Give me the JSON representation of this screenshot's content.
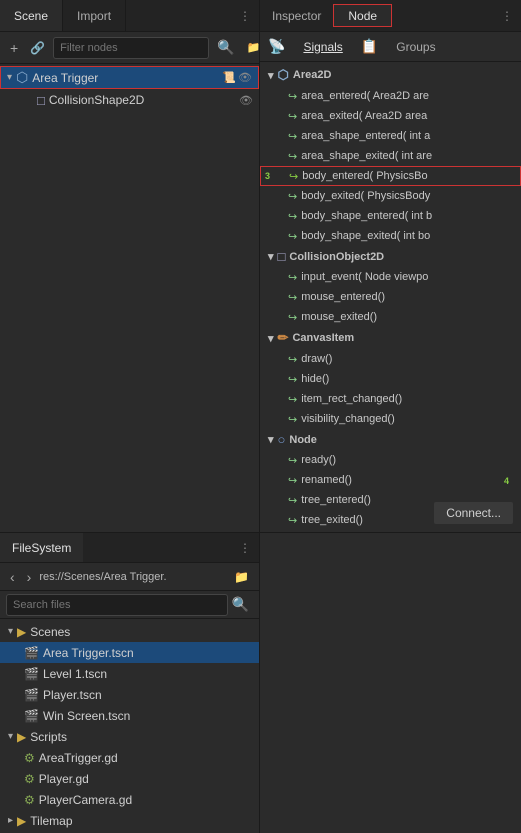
{
  "scene_panel": {
    "tabs": [
      {
        "label": "Scene",
        "active": true
      },
      {
        "label": "Import",
        "active": false
      }
    ],
    "toolbar": {
      "add_label": "+",
      "link_label": "🔗",
      "filter_placeholder": "Filter nodes",
      "search_label": "🔍",
      "folder_label": "📁"
    },
    "tree": [
      {
        "id": "area_trigger",
        "label": "Area Trigger",
        "icon": "⬡",
        "indent": 0,
        "selected": true,
        "has_script": true,
        "visible": true
      },
      {
        "id": "collision_shape",
        "label": "CollisionShape2D",
        "icon": "□",
        "indent": 1,
        "selected": false,
        "has_script": false,
        "visible": true
      }
    ]
  },
  "inspector_panel": {
    "title": "Inspector",
    "tabs": [
      {
        "label": "Node",
        "active": true
      }
    ],
    "sub_tabs": [
      {
        "label": "Signals",
        "active": true,
        "icon": "📡"
      },
      {
        "label": "",
        "icon": "📋"
      },
      {
        "label": "Groups",
        "active": false
      }
    ],
    "signal_groups": [
      {
        "name": "Area2D",
        "signals": [
          {
            "name": "area_entered( Area2D are",
            "connected": false,
            "highlighted": false
          },
          {
            "name": "area_exited( Area2D area",
            "connected": false,
            "highlighted": false
          },
          {
            "name": "area_shape_entered( int a",
            "connected": false,
            "highlighted": false
          },
          {
            "name": "area_shape_exited( int are",
            "connected": false,
            "highlighted": false
          },
          {
            "name": "body_entered( PhysicsBo",
            "connected": true,
            "highlighted": true
          },
          {
            "name": "body_exited( PhysicsBody",
            "connected": false,
            "highlighted": false
          },
          {
            "name": "body_shape_entered( int b",
            "connected": false,
            "highlighted": false
          },
          {
            "name": "body_shape_exited( int bo",
            "connected": false,
            "highlighted": false
          }
        ]
      },
      {
        "name": "CollisionObject2D",
        "signals": [
          {
            "name": "input_event( Node viewpo",
            "connected": false,
            "highlighted": false
          },
          {
            "name": "mouse_entered()",
            "connected": false,
            "highlighted": false
          },
          {
            "name": "mouse_exited()",
            "connected": false,
            "highlighted": false
          }
        ]
      },
      {
        "name": "CanvasItem",
        "signals": [
          {
            "name": "draw()",
            "connected": false,
            "highlighted": false
          },
          {
            "name": "hide()",
            "connected": false,
            "highlighted": false
          },
          {
            "name": "item_rect_changed()",
            "connected": false,
            "highlighted": false
          },
          {
            "name": "visibility_changed()",
            "connected": false,
            "highlighted": false
          }
        ]
      },
      {
        "name": "Node",
        "signals": [
          {
            "name": "ready()",
            "connected": false,
            "highlighted": false
          },
          {
            "name": "renamed()",
            "connected": false,
            "highlighted": false
          },
          {
            "name": "tree_entered()",
            "connected": false,
            "highlighted": false
          },
          {
            "name": "tree_exited()",
            "connected": false,
            "highlighted": false
          }
        ]
      }
    ],
    "connect_btn_label": "Connect...",
    "badge_number": "3",
    "badge_number2": "4"
  },
  "filesystem_panel": {
    "tabs": [
      {
        "label": "FileSystem",
        "active": true
      }
    ],
    "breadcrumb": {
      "path": "res://Scenes/Area Trigger.",
      "icon_left": "‹",
      "icon_right": "›",
      "folder_icon": "📁"
    },
    "search_placeholder": "Search files",
    "tree": [
      {
        "type": "folder",
        "label": "Scenes",
        "indent": 0,
        "expanded": true
      },
      {
        "type": "scene",
        "label": "Area Trigger.tscn",
        "indent": 1,
        "selected": true
      },
      {
        "type": "scene",
        "label": "Level 1.tscn",
        "indent": 1
      },
      {
        "type": "scene",
        "label": "Player.tscn",
        "indent": 1
      },
      {
        "type": "scene",
        "label": "Win Screen.tscn",
        "indent": 1
      },
      {
        "type": "folder",
        "label": "Scripts",
        "indent": 0,
        "expanded": true
      },
      {
        "type": "script",
        "label": "AreaTrigger.gd",
        "indent": 1
      },
      {
        "type": "script",
        "label": "Player.gd",
        "indent": 1
      },
      {
        "type": "script",
        "label": "PlayerCamera.gd",
        "indent": 1
      },
      {
        "type": "folder",
        "label": "Tilemap",
        "indent": 0
      }
    ]
  }
}
